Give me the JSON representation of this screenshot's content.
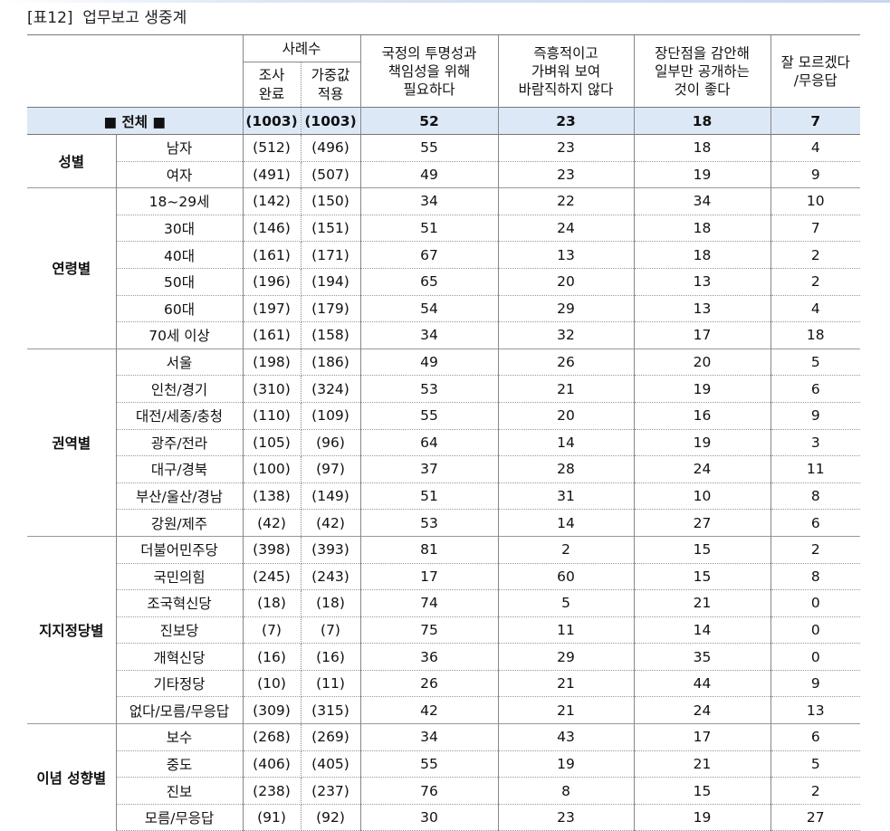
{
  "title": "[표12]  업무보고 생중계",
  "header": {
    "cases": "사례수",
    "completed": "조사\n완료",
    "weighted": "가중값\n적용",
    "col_a": "국정의 투명성과\n책임성을 위해\n필요하다",
    "col_b": "즉흥적이고\n가벼워 보여\n바람직하지 않다",
    "col_c": "장단점을 감안해\n일부만 공개하는\n것이 좋다",
    "col_d": "잘 모르겠다\n/무응답"
  },
  "total": {
    "label": "■ 전체 ■",
    "n": "(1003)",
    "w": "(1003)",
    "a": "52",
    "b": "23",
    "c": "18",
    "d": "7"
  },
  "groups": [
    {
      "name": "성별",
      "rows": [
        {
          "label": "남자",
          "n": "(512)",
          "w": "(496)",
          "a": "55",
          "b": "23",
          "c": "18",
          "d": "4"
        },
        {
          "label": "여자",
          "n": "(491)",
          "w": "(507)",
          "a": "49",
          "b": "23",
          "c": "19",
          "d": "9"
        }
      ]
    },
    {
      "name": "연령별",
      "rows": [
        {
          "label": "18~29세",
          "n": "(142)",
          "w": "(150)",
          "a": "34",
          "b": "22",
          "c": "34",
          "d": "10"
        },
        {
          "label": "30대",
          "n": "(146)",
          "w": "(151)",
          "a": "51",
          "b": "24",
          "c": "18",
          "d": "7"
        },
        {
          "label": "40대",
          "n": "(161)",
          "w": "(171)",
          "a": "67",
          "b": "13",
          "c": "18",
          "d": "2"
        },
        {
          "label": "50대",
          "n": "(196)",
          "w": "(194)",
          "a": "65",
          "b": "20",
          "c": "13",
          "d": "2"
        },
        {
          "label": "60대",
          "n": "(197)",
          "w": "(179)",
          "a": "54",
          "b": "29",
          "c": "13",
          "d": "4"
        },
        {
          "label": "70세 이상",
          "n": "(161)",
          "w": "(158)",
          "a": "34",
          "b": "32",
          "c": "17",
          "d": "18"
        }
      ]
    },
    {
      "name": "권역별",
      "rows": [
        {
          "label": "서울",
          "n": "(198)",
          "w": "(186)",
          "a": "49",
          "b": "26",
          "c": "20",
          "d": "5"
        },
        {
          "label": "인천/경기",
          "n": "(310)",
          "w": "(324)",
          "a": "53",
          "b": "21",
          "c": "19",
          "d": "6"
        },
        {
          "label": "대전/세종/충청",
          "n": "(110)",
          "w": "(109)",
          "a": "55",
          "b": "20",
          "c": "16",
          "d": "9"
        },
        {
          "label": "광주/전라",
          "n": "(105)",
          "w": "(96)",
          "a": "64",
          "b": "14",
          "c": "19",
          "d": "3"
        },
        {
          "label": "대구/경북",
          "n": "(100)",
          "w": "(97)",
          "a": "37",
          "b": "28",
          "c": "24",
          "d": "11"
        },
        {
          "label": "부산/울산/경남",
          "n": "(138)",
          "w": "(149)",
          "a": "51",
          "b": "31",
          "c": "10",
          "d": "8"
        },
        {
          "label": "강원/제주",
          "n": "(42)",
          "w": "(42)",
          "a": "53",
          "b": "14",
          "c": "27",
          "d": "6"
        }
      ]
    },
    {
      "name": "지지정당별",
      "rows": [
        {
          "label": "더불어민주당",
          "n": "(398)",
          "w": "(393)",
          "a": "81",
          "b": "2",
          "c": "15",
          "d": "2"
        },
        {
          "label": "국민의힘",
          "n": "(245)",
          "w": "(243)",
          "a": "17",
          "b": "60",
          "c": "15",
          "d": "8"
        },
        {
          "label": "조국혁신당",
          "n": "(18)",
          "w": "(18)",
          "a": "74",
          "b": "5",
          "c": "21",
          "d": "0"
        },
        {
          "label": "진보당",
          "n": "(7)",
          "w": "(7)",
          "a": "75",
          "b": "11",
          "c": "14",
          "d": "0"
        },
        {
          "label": "개혁신당",
          "n": "(16)",
          "w": "(16)",
          "a": "36",
          "b": "29",
          "c": "35",
          "d": "0"
        },
        {
          "label": "기타정당",
          "n": "(10)",
          "w": "(11)",
          "a": "26",
          "b": "21",
          "c": "44",
          "d": "9"
        },
        {
          "label": "없다/모름/무응답",
          "n": "(309)",
          "w": "(315)",
          "a": "42",
          "b": "21",
          "c": "24",
          "d": "13"
        }
      ]
    },
    {
      "name": "이념 성향별",
      "rows": [
        {
          "label": "보수",
          "n": "(268)",
          "w": "(269)",
          "a": "34",
          "b": "43",
          "c": "17",
          "d": "6"
        },
        {
          "label": "중도",
          "n": "(406)",
          "w": "(405)",
          "a": "55",
          "b": "19",
          "c": "21",
          "d": "5"
        },
        {
          "label": "진보",
          "n": "(238)",
          "w": "(237)",
          "a": "76",
          "b": "8",
          "c": "15",
          "d": "2"
        },
        {
          "label": "모름/무응답",
          "n": "(91)",
          "w": "(92)",
          "a": "30",
          "b": "23",
          "c": "19",
          "d": "27"
        }
      ]
    }
  ]
}
